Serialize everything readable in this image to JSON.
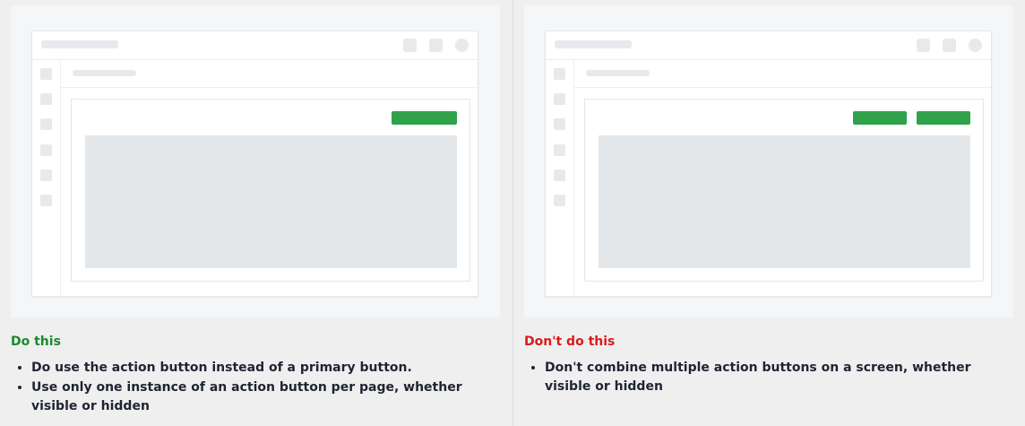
{
  "do_panel": {
    "heading": "Do this",
    "heading_color": "#1a8a2c",
    "action_button_color": "#2fa24b",
    "points": [
      "Do use the action button instead of a primary button.",
      "Use only one instance of an action button per page, whether visible or hidden"
    ]
  },
  "dont_panel": {
    "heading": "Don't do this",
    "heading_color": "#d81b1b",
    "action_button_color": "#2fa24b",
    "points": [
      "Don't combine multiple action buttons on a screen, whether visible or hidden"
    ]
  }
}
